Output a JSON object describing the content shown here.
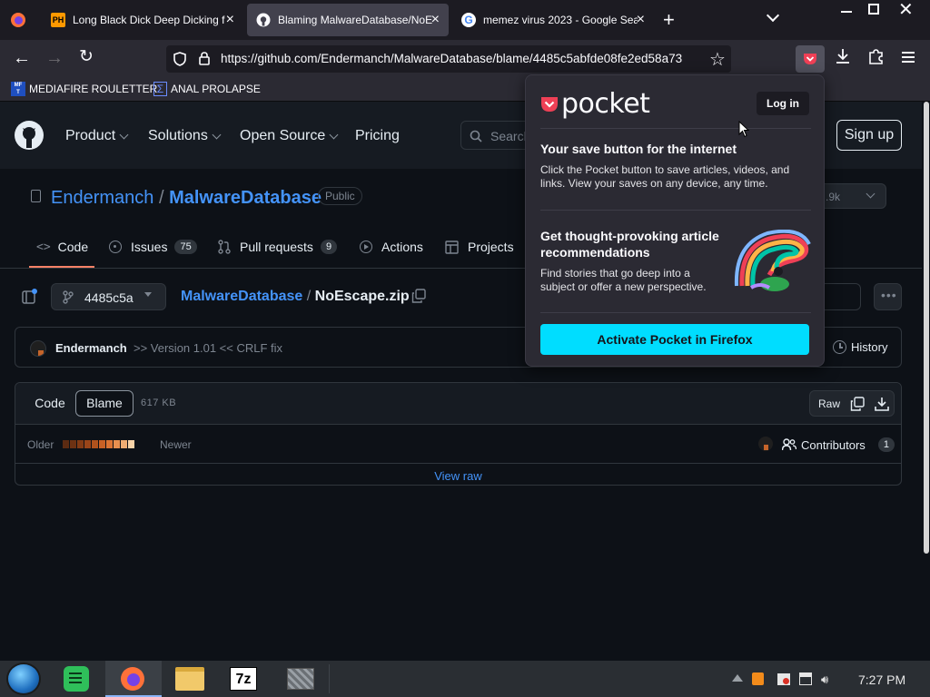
{
  "browser": {
    "tabs": [
      {
        "title": "Long Black Dick Deep Dicking f"
      },
      {
        "title": "Blaming MalwareDatabase/NoE"
      },
      {
        "title": "memez virus 2023 - Google Sea"
      }
    ],
    "new_tab": "+",
    "url": "https://github.com/Endermanch/MalwareDatabase/blame/4485c5abfde08fe2ed58a73",
    "bookmarks": [
      {
        "label": "MEDIAFIRE ROULETTER"
      },
      {
        "label": "ANAL PROLAPSE"
      }
    ]
  },
  "github": {
    "nav": {
      "product": "Product",
      "solutions": "Solutions",
      "open_source": "Open Source",
      "pricing": "Pricing",
      "search_placeholder": "Search",
      "sign_up": "Sign up"
    },
    "repo": {
      "owner": "Endermanch",
      "sep": "/",
      "name": "MalwareDatabase",
      "visibility": "Public",
      "stars_count": ".9k"
    },
    "tabs": [
      {
        "label": "Code"
      },
      {
        "label": "Issues",
        "count": "75"
      },
      {
        "label": "Pull requests",
        "count": "9"
      },
      {
        "label": "Actions"
      },
      {
        "label": "Projects"
      }
    ],
    "file": {
      "branch": "4485c5a",
      "repo_link": "MalwareDatabase",
      "sep": "/",
      "filename": "NoEscape.zip"
    },
    "commit": {
      "author": "Endermanch",
      "message": ">> Version 1.01 << CRLF fix",
      "history": "History"
    },
    "viewer": {
      "code": "Code",
      "blame": "Blame",
      "size": "617 KB",
      "raw": "Raw",
      "older": "Older",
      "newer": "Newer",
      "contributors": "Contributors",
      "contributors_count": "1",
      "view_raw": "View raw"
    }
  },
  "pocket": {
    "logo": "pocket",
    "login": "Log in",
    "h1": "Your save button for the internet",
    "p1": "Click the Pocket button to save articles, videos, and links. View your saves on any device, any time.",
    "h2": "Get thought-provoking article recommendations",
    "p2": "Find stories that go deep into a subject or offer a new perspective.",
    "cta": "Activate Pocket in Firefox"
  },
  "taskbar": {
    "clock": "7:27 PM",
    "app_7z": "7z"
  },
  "colors": {
    "pocket_red": "#ef4056",
    "pocket_cta": "#00ddff",
    "gh_link": "#4493f8"
  }
}
